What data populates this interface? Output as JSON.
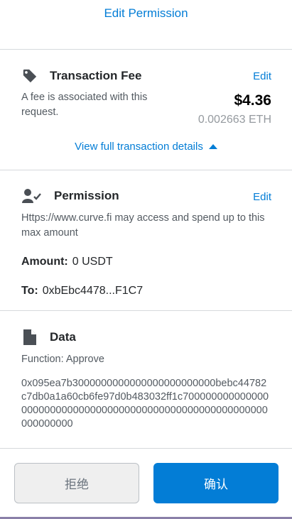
{
  "header": {
    "edit_permission": "Edit Permission"
  },
  "fee": {
    "title": "Transaction Fee",
    "edit": "Edit",
    "description": "A fee is associated with this request.",
    "usd": "$4.36",
    "eth": "0.002663 ETH",
    "view_details": "View full transaction details"
  },
  "permission": {
    "title": "Permission",
    "edit": "Edit",
    "description": "Https://www.curve.fi may access and spend up to this max amount",
    "amount_label": "Amount:",
    "amount_value": "0 USDT",
    "to_label": "To:",
    "to_value": "0xbEbc4478...F1C7"
  },
  "data": {
    "title": "Data",
    "function": "Function: Approve",
    "hex": "0x095ea7b3000000000000000000000000bebc44782c7db0a1a60cb6fe97d0b483032ff1c7000000000000000000000000000000000000000000000000000000000000000000"
  },
  "buttons": {
    "reject": "拒绝",
    "confirm": "确认"
  },
  "icons": {
    "fee": "tag-icon",
    "permission": "user-check-icon",
    "data": "file-icon",
    "caret": "caret-up-icon"
  },
  "colors": {
    "accent": "#037dd6",
    "text": "#24272a",
    "muted": "#535a61",
    "divider": "#d6d9dc"
  }
}
